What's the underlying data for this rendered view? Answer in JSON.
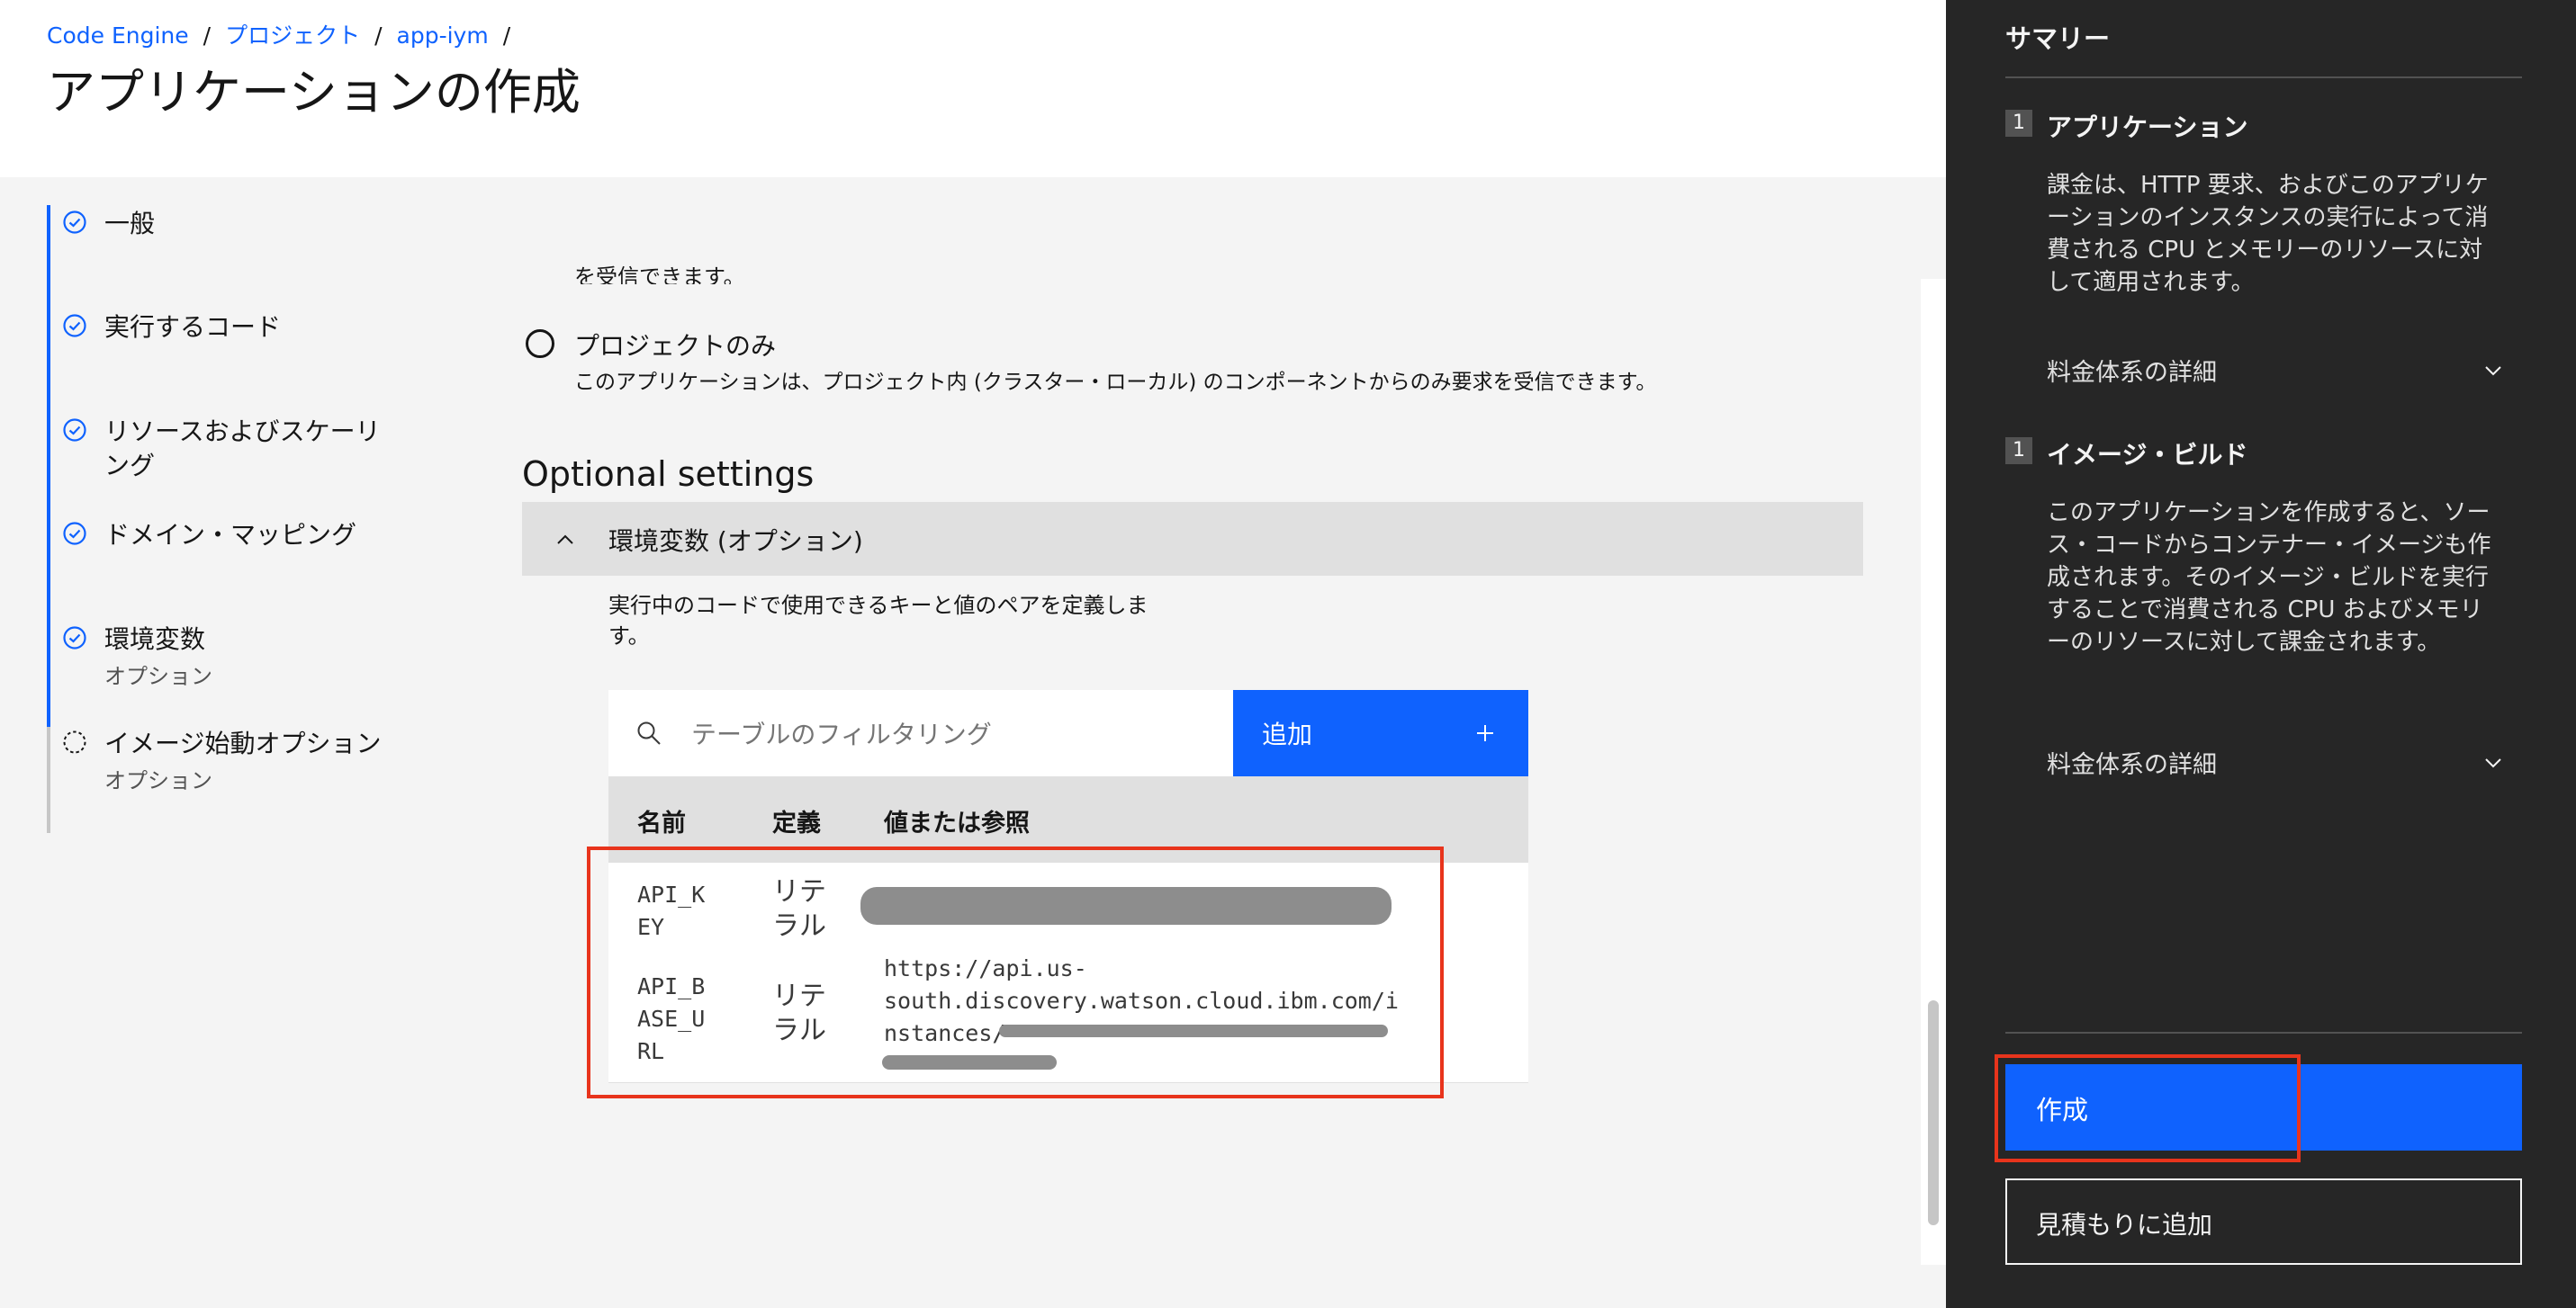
{
  "breadcrumb": {
    "items": [
      "Code Engine",
      "プロジェクト",
      "app-iym"
    ],
    "separator": "/"
  },
  "page_title": "アプリケーションの作成",
  "nav": {
    "steps": [
      {
        "label": "一般",
        "status": "complete"
      },
      {
        "label": "実行するコード",
        "status": "complete"
      },
      {
        "label": "リソースおよびスケーリング",
        "status": "complete"
      },
      {
        "label": "ドメイン・マッピング",
        "status": "complete"
      },
      {
        "label": "環境変数",
        "sublabel": "オプション",
        "status": "complete"
      },
      {
        "label": "イメージ始動オプション",
        "sublabel": "オプション",
        "status": "incomplete"
      }
    ]
  },
  "endpoint": {
    "cut_text": "を受信できます。",
    "option_label": "プロジェクトのみ",
    "option_desc": "このアプリケーションは、プロジェクト内 (クラスター・ローカル) のコンポーネントからのみ要求を受信できます。"
  },
  "optional": {
    "title": "Optional settings",
    "accordion_label": "環境変数 (オプション)",
    "accordion_desc": "実行中のコードで使用できるキーと値のペアを定義します。"
  },
  "env_table": {
    "search_placeholder": "テーブルのフィルタリング",
    "add_label": "追加",
    "add_icon": "plus-icon",
    "headers": [
      "名前",
      "定義",
      "値または参照"
    ],
    "rows": [
      {
        "name": "API_K\nEY",
        "definition": "リテ\nラル",
        "value": "",
        "value_redacted": true
      },
      {
        "name": "API_B\nASE_U\nRL",
        "definition": "リテ\nラル",
        "value": "https://api.us-\nsouth.discovery.watson.cloud.ibm.com/i\nnstances/",
        "value_redacted": true
      }
    ]
  },
  "summary": {
    "title": "サマリー",
    "sections": [
      {
        "number": "1",
        "heading": "アプリケーション",
        "text": "課金は、HTTP 要求、およびこのアプリケーションのインスタンスの実行によって消費される CPU とメモリーのリソースに対して適用されます。",
        "link": "料金体系の詳細"
      },
      {
        "number": "1",
        "heading": "イメージ・ビルド",
        "text": "このアプリケーションを作成すると、ソース・コードからコンテナー・イメージも作成されます。そのイメージ・ビルドを実行することで消費される CPU およびメモリーのリソースに対して課金されます。",
        "link": "料金体系の詳細"
      }
    ],
    "create_label": "作成",
    "estimate_label": "見積もりに追加"
  },
  "colors": {
    "accent": "#0f62fe",
    "summary_bg": "#262626",
    "highlight_red": "#e8341c"
  }
}
